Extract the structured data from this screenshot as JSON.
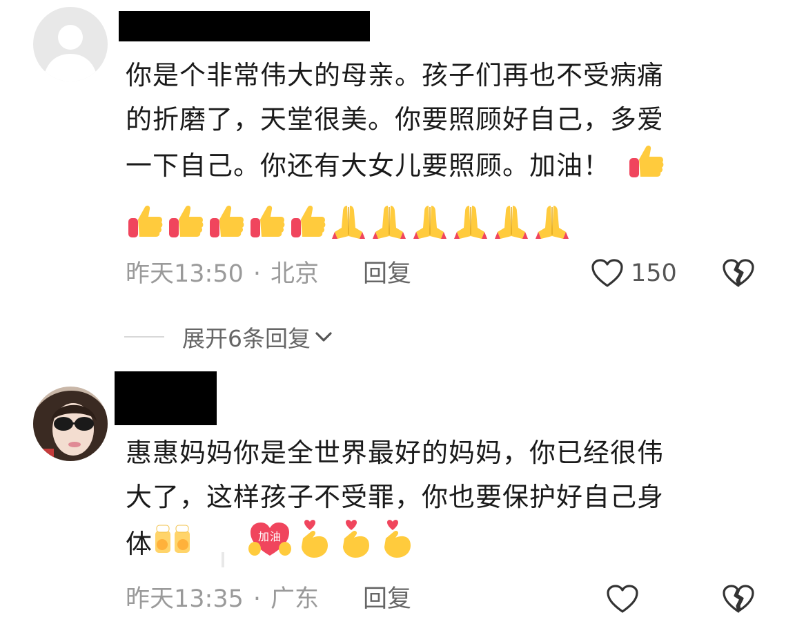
{
  "comments": [
    {
      "text_lines": [
        "你是个非常伟大的母亲。孩子们再也不受病痛",
        "的折磨了，天堂很美。你要照顾好自己，多爱",
        "一下自己。你还有大女儿要照顾。加油！"
      ],
      "emoji_inline": [
        "thumbs-up-icon"
      ],
      "emoji_row": [
        "thumbs-up-icon",
        "thumbs-up-icon",
        "thumbs-up-icon",
        "thumbs-up-icon",
        "thumbs-up-icon",
        "pray-icon",
        "pray-icon",
        "pray-icon",
        "pray-icon",
        "pray-icon",
        "pray-icon"
      ],
      "time": "昨天13:50",
      "separator": "·",
      "location": "北京",
      "reply_label": "回复",
      "like_count": "150",
      "expand_label": "展开6条回复"
    },
    {
      "text_lines": [
        "惠惠妈妈你是全世界最好的妈妈，你已经很伟",
        "大了，这样孩子不受罪，你也要保护好自己身",
        "体"
      ],
      "emoji_inline": [
        "cheers-icon",
        "hug-jiayou-icon",
        "finger-heart-icon",
        "finger-heart-icon",
        "finger-heart-icon"
      ],
      "jiayou_sticker_text": "加油",
      "time": "昨天13:35",
      "separator": "·",
      "location": "广东",
      "reply_label": "回复"
    }
  ],
  "colors": {
    "text": "#1a1a1a",
    "meta": "#9a9a9a",
    "icon_stroke": "#333333"
  }
}
